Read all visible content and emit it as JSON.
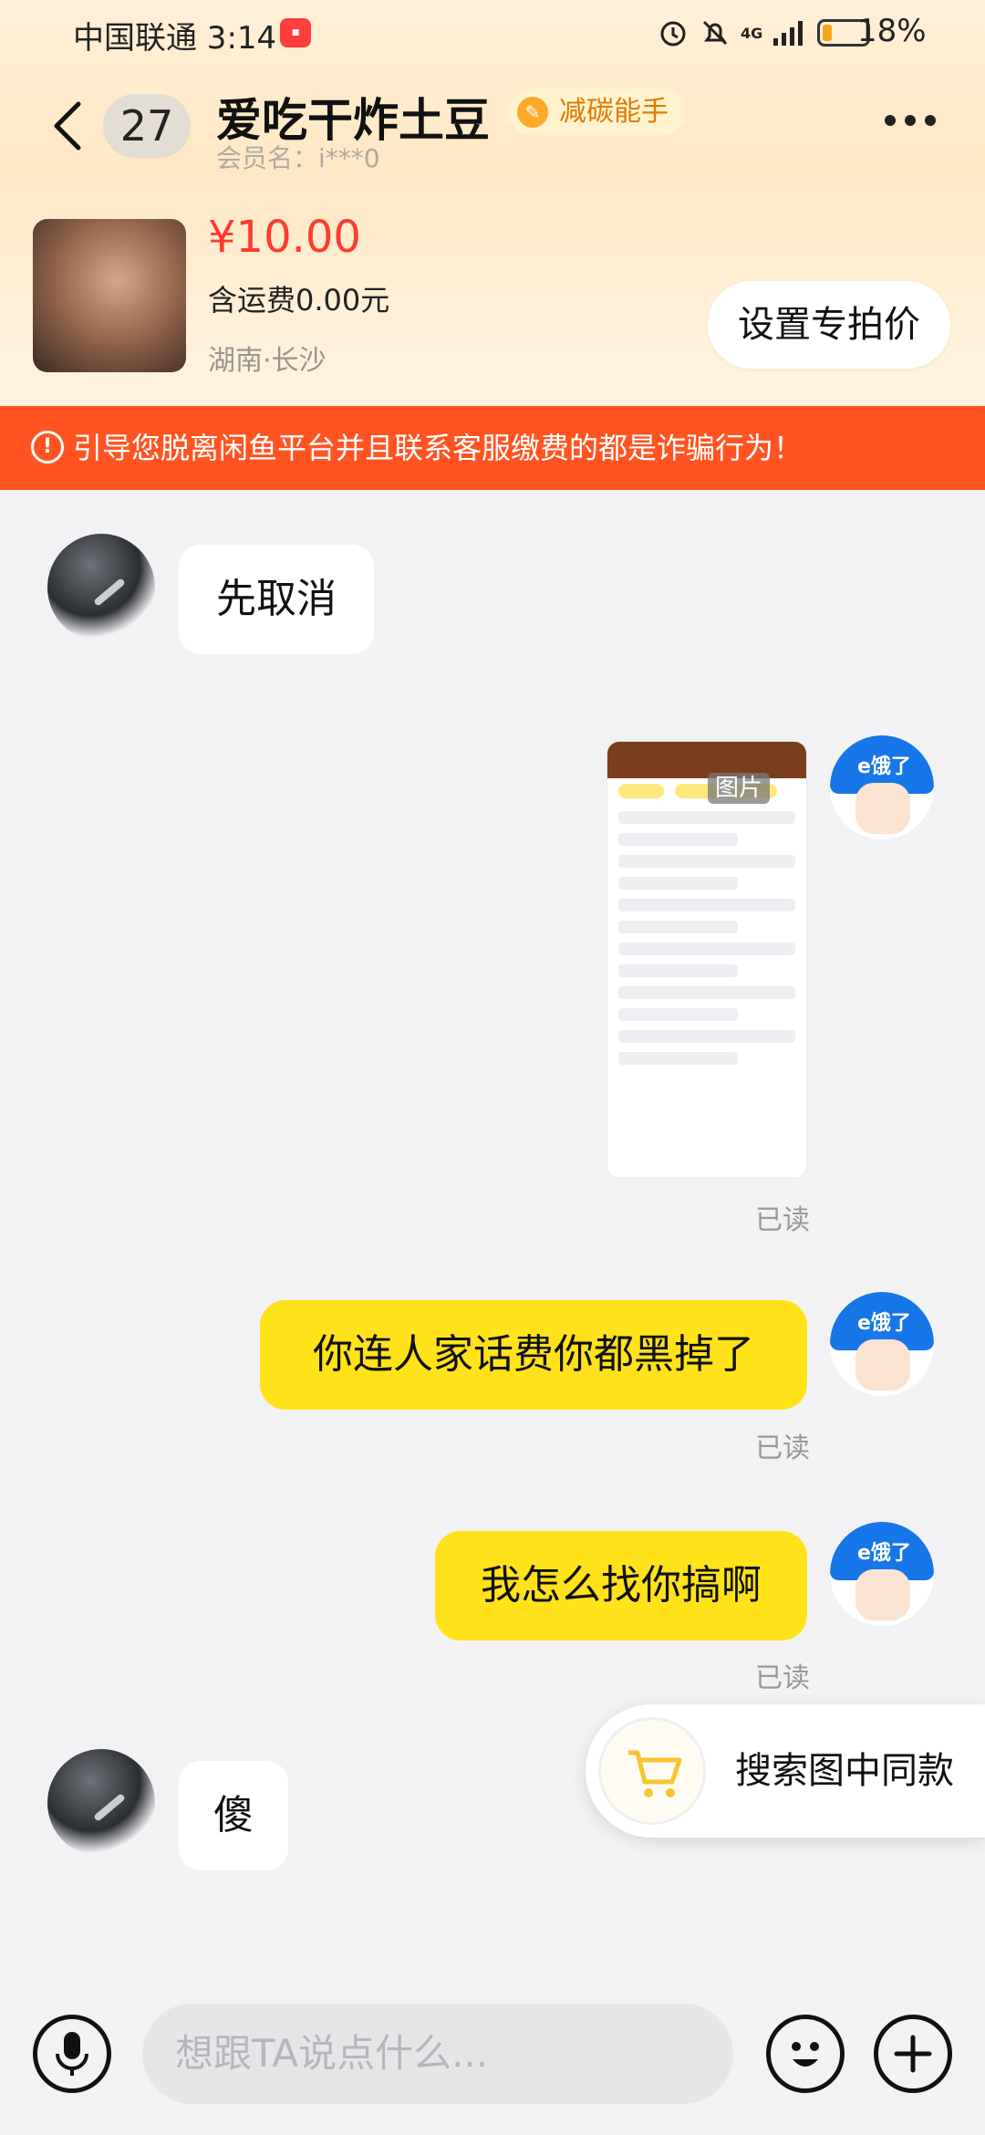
{
  "status_bar": {
    "carrier_time": "中国联通 3:14",
    "network": "4G",
    "battery": "18%",
    "battery_level": 0.18
  },
  "header": {
    "unread_count": "27",
    "title": "爱吃干炸土豆",
    "badge": "减碳能手",
    "member_label": "会员名：i***0"
  },
  "product": {
    "price": "¥10.00",
    "shipping": "含运费0.00元",
    "location": "湖南·长沙",
    "set_price_button": "设置专拍价"
  },
  "warning": "引导您脱离闲鱼平台并且联系客服缴费的都是诈骗行为！",
  "messages": [
    {
      "side": "left",
      "text": "先取消"
    },
    {
      "side": "right",
      "type": "image",
      "tag": "图片",
      "read": "已读"
    },
    {
      "side": "right",
      "text": "你连人家话费你都黑掉了",
      "read": "已读"
    },
    {
      "side": "right",
      "text": "我怎么找你搞啊",
      "read": "已读"
    },
    {
      "side": "left",
      "text": "傻"
    }
  ],
  "search_popup": {
    "label": "搜索图中同款"
  },
  "input": {
    "placeholder": "想跟TA说点什么..."
  },
  "colors": {
    "accent": "#ff5422",
    "bubble_right": "#ffe21a",
    "price": "#ff3a2f"
  }
}
